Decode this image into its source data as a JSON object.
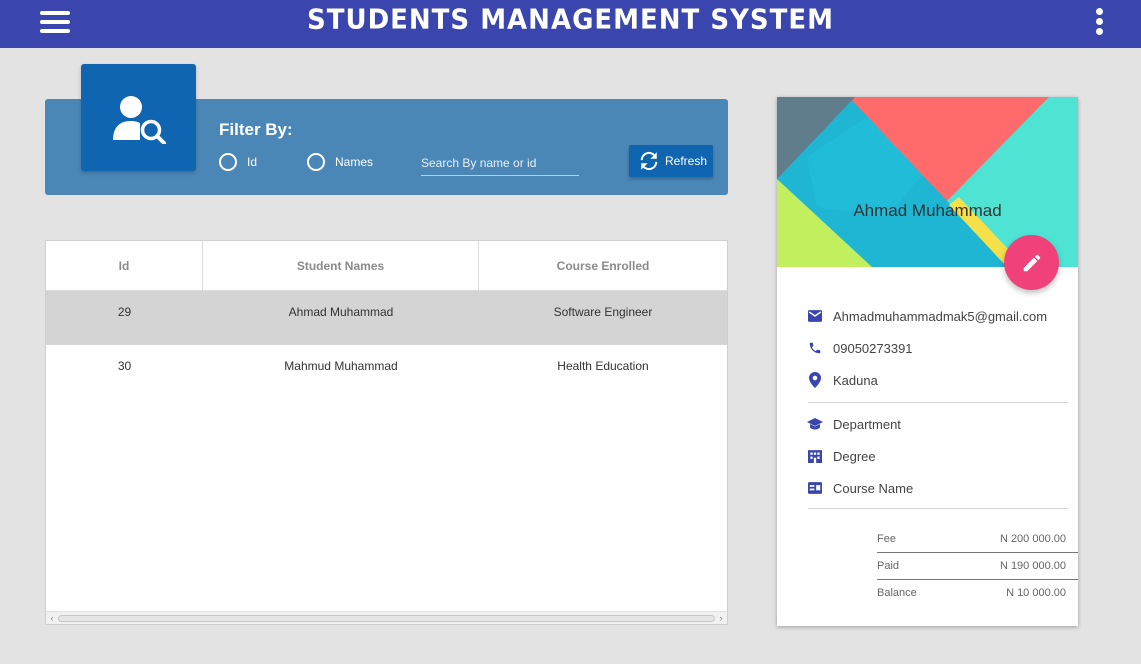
{
  "header": {
    "title": "STUDENTS MANAGEMENT SYSTEM",
    "menu_icon": "hamburger-icon",
    "more_icon": "more-vert-icon",
    "color": "#3a46ad"
  },
  "filter": {
    "label": "Filter By:",
    "icon": "user-search-icon",
    "options": [
      {
        "label": "Id",
        "selected": false
      },
      {
        "label": "Names",
        "selected": false
      }
    ],
    "search_placeholder": "Search By name or id",
    "search_value": "",
    "refresh_label": "Refresh",
    "panel_color": "#4a87b7",
    "button_color": "#0f65af"
  },
  "table": {
    "columns": [
      "Id",
      "Student Names",
      "Course Enrolled"
    ],
    "rows": [
      {
        "id": "29",
        "name": "Ahmad Muhammad",
        "course": "Software Engineer",
        "selected": true
      },
      {
        "id": "30",
        "name": "Mahmud Muhammad",
        "course": "Health Education",
        "selected": false
      }
    ]
  },
  "profile": {
    "name": "Ahmad Muhammad",
    "email": "Ahmadmuhammadmak5@gmail.com",
    "phone": "09050273391",
    "location": "Kaduna",
    "department": "Department",
    "degree": "Degree",
    "course": "Course Name",
    "edit_icon": "pencil-icon",
    "accent": "#f0417a",
    "fees": [
      {
        "label": "Fee",
        "value": "N 200 000.00"
      },
      {
        "label": "Paid",
        "value": "N 190 000.00"
      },
      {
        "label": "Balance",
        "value": "N 10 000.00"
      }
    ]
  }
}
